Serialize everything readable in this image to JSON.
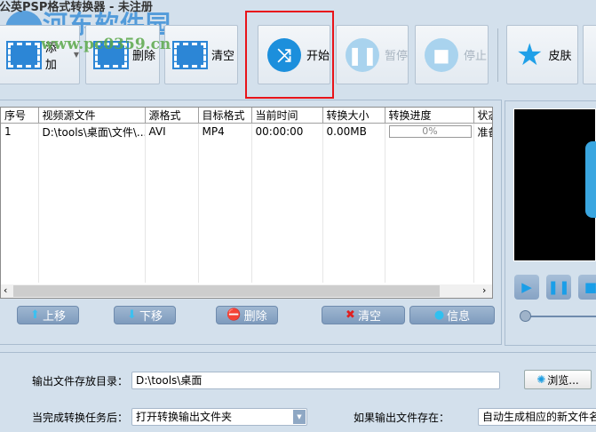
{
  "window": {
    "title": "蒲公英PSP格式转换器 - 未注册"
  },
  "watermark": {
    "name": "河东软件园",
    "url": "www.pc0359.cn"
  },
  "toolbar": {
    "add": "添加",
    "delete": "删除",
    "clear": "清空",
    "start": "开始",
    "pause": "暂停",
    "stop": "停止",
    "skin": "皮肤"
  },
  "table": {
    "headers": [
      "序号",
      "视频源文件",
      "源格式",
      "目标格式",
      "当前时间",
      "转换大小",
      "转换进度",
      "状态"
    ],
    "rows": [
      {
        "index": "1",
        "file": "D:\\tools\\桌面\\文件\\...",
        "src": "AVI",
        "dst": "MP4",
        "time": "00:00:00",
        "size": "0.00MB",
        "progress": "0%",
        "status": "准备"
      }
    ]
  },
  "list_buttons": {
    "up": "上移",
    "down": "下移",
    "delete": "删除",
    "clear": "清空",
    "info": "信息"
  },
  "output": {
    "dir_label": "输出文件存放目录：",
    "dir_value": "D:\\tools\\桌面",
    "browse": "浏览...",
    "after_label": "当完成转换任务后：",
    "after_value": "打开转换输出文件夹",
    "exists_label": "如果输出文件存在：",
    "exists_value": "自动生成相应的新文件名"
  },
  "colors": {
    "accent": "#1c8fdc",
    "highlight": "#e8141a"
  }
}
